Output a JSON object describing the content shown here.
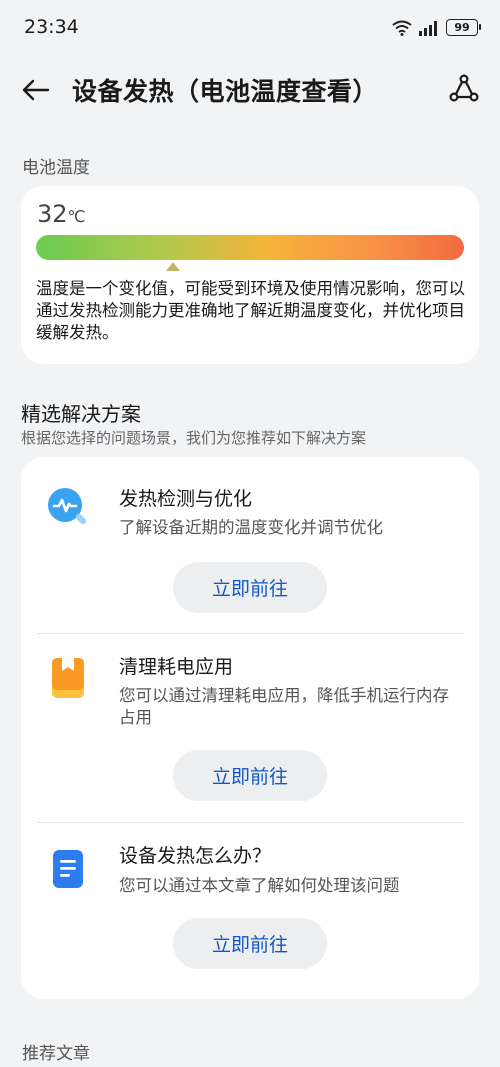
{
  "status": {
    "time": "23:34",
    "battery": "99"
  },
  "header": {
    "title": "设备发热（电池温度查看）"
  },
  "battery_section": {
    "label": "电池温度",
    "temperature_value": "32",
    "temperature_unit": "℃",
    "temperature_level": 0.32,
    "description": "温度是一个变化值，可能受到环境及使用情况影响，您可以通过发热检测能力更准确地了解近期温度变化，并优化项目缓解发热。"
  },
  "solutions": {
    "title": "精选解决方案",
    "subtitle": "根据您选择的问题场景，我们为您推荐如下解决方案",
    "items": [
      {
        "icon": "heat-detection-icon",
        "title": "发热检测与优化",
        "description": "了解设备近期的温度变化并调节优化",
        "button": "立即前往"
      },
      {
        "icon": "app-cleanup-icon",
        "title": "清理耗电应用",
        "description": "您可以通过清理耗电应用，降低手机运行内存占用",
        "button": "立即前往"
      },
      {
        "icon": "article-icon",
        "title": "设备发热怎么办？",
        "description": "您可以通过本文章了解如何处理该问题",
        "button": "立即前往"
      }
    ]
  },
  "articles": {
    "label": "推荐文章"
  },
  "colors": {
    "accent": "#1458c6",
    "background": "#f1f3f5",
    "card": "#ffffff"
  }
}
